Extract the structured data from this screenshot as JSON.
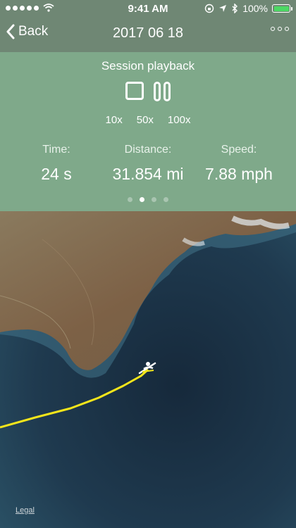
{
  "status_bar": {
    "time": "9:41 AM",
    "battery": "100%",
    "icons": [
      "signal-dots",
      "wifi-icon",
      "lock-rotation-icon",
      "location-arrow-icon",
      "bluetooth-icon",
      "battery-icon"
    ]
  },
  "nav": {
    "back_label": "Back",
    "title": "2017 06 18",
    "more_icon": "more-dots-icon"
  },
  "playback": {
    "title": "Session playback",
    "controls": [
      "stop-icon",
      "pause-icon"
    ],
    "speeds": [
      "10x",
      "50x",
      "100x"
    ]
  },
  "stats": {
    "time_label": "Time:",
    "time_value": "24 s",
    "distance_label": "Distance:",
    "distance_value": "31.854 mi",
    "speed_label": "Speed:",
    "speed_value": "7.88 mph"
  },
  "pager": {
    "count": 4,
    "active_index": 1
  },
  "map": {
    "legal_label": "Legal",
    "marker_icon": "kayak-icon",
    "track_color": "#f3e51b"
  }
}
